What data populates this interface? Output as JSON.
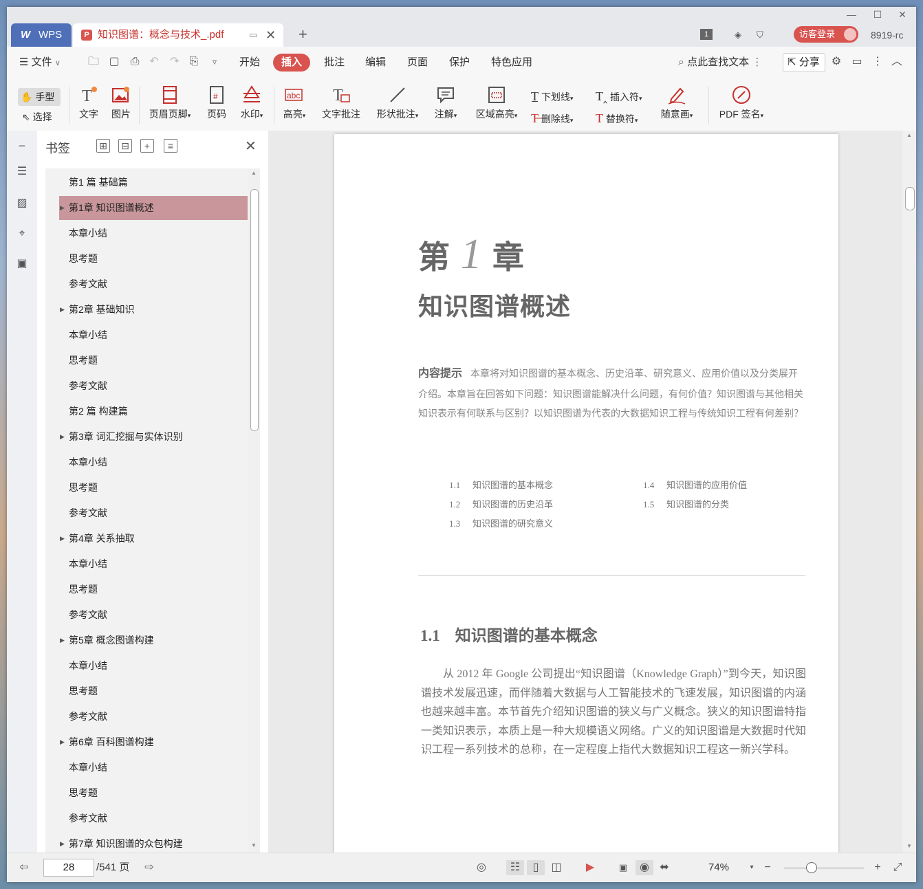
{
  "titlebar": {
    "app_tab": "WPS",
    "doc_tab": "知识图谱：概念与技术_.pdf",
    "page_indicator": "1",
    "login": "访客登录",
    "version": "8919-rc"
  },
  "menu": {
    "file": "文件",
    "tabs": [
      "开始",
      "插入",
      "批注",
      "编辑",
      "页面",
      "保护",
      "特色应用"
    ],
    "active_tab": "插入",
    "search": "点此查找文本",
    "share": "分享"
  },
  "ribbon": {
    "hand": "手型",
    "select": "选择",
    "text": "文字",
    "image": "图片",
    "header_footer": "页眉页脚",
    "page_num": "页码",
    "watermark": "水印",
    "highlight": "高亮",
    "text_annot": "文字批注",
    "shape_annot": "形状批注",
    "note": "注解",
    "area_highlight": "区域高亮",
    "underline": "下划线",
    "strikethrough": "删除线",
    "insert_char": "插入符",
    "replace_char": "替换符",
    "freehand": "随意画",
    "pdf_sign": "PDF 签名"
  },
  "bookmarks": {
    "title": "书签",
    "items": [
      {
        "label": "第1 篇 基础篇",
        "arrow": false
      },
      {
        "label": "第1章 知识图谱概述",
        "arrow": true,
        "selected": true
      },
      {
        "label": "本章小结",
        "arrow": false
      },
      {
        "label": "思考题",
        "arrow": false
      },
      {
        "label": "参考文献",
        "arrow": false
      },
      {
        "label": "第2章 基础知识",
        "arrow": true
      },
      {
        "label": "本章小结",
        "arrow": false
      },
      {
        "label": "思考题",
        "arrow": false
      },
      {
        "label": "参考文献",
        "arrow": false
      },
      {
        "label": "第2 篇 构建篇",
        "arrow": false
      },
      {
        "label": "第3章 词汇挖掘与实体识别",
        "arrow": true
      },
      {
        "label": "本章小结",
        "arrow": false
      },
      {
        "label": "思考题",
        "arrow": false
      },
      {
        "label": "参考文献",
        "arrow": false
      },
      {
        "label": "第4章 关系抽取",
        "arrow": true
      },
      {
        "label": "本章小结",
        "arrow": false
      },
      {
        "label": "思考题",
        "arrow": false
      },
      {
        "label": "参考文献",
        "arrow": false
      },
      {
        "label": "第5章 概念图谱构建",
        "arrow": true
      },
      {
        "label": "本章小结",
        "arrow": false
      },
      {
        "label": "思考题",
        "arrow": false
      },
      {
        "label": "参考文献",
        "arrow": false
      },
      {
        "label": "第6章 百科图谱构建",
        "arrow": true
      },
      {
        "label": "本章小结",
        "arrow": false
      },
      {
        "label": "思考题",
        "arrow": false
      },
      {
        "label": "参考文献",
        "arrow": false
      },
      {
        "label": "第7章 知识图谱的众包构建",
        "arrow": true
      }
    ]
  },
  "page": {
    "chapter_prefix": "第",
    "chapter_num": "1",
    "chapter_suffix": "章",
    "chapter_title": "知识图谱概述",
    "hint_label": "内容提示",
    "hint_text": "本章将对知识图谱的基本概念、历史沿革、研究意义、应用价值以及分类展开介绍。本章旨在回答如下问题：知识图谱能解决什么问题，有何价值？知识图谱与其他相关知识表示有何联系与区别？以知识图谱为代表的大数据知识工程与传统知识工程有何差别？",
    "toc": [
      {
        "no": "1.1",
        "title": "知识图谱的基本概念"
      },
      {
        "no": "1.2",
        "title": "知识图谱的历史沿革"
      },
      {
        "no": "1.3",
        "title": "知识图谱的研究意义"
      },
      {
        "no": "1.4",
        "title": "知识图谱的应用价值"
      },
      {
        "no": "1.5",
        "title": "知识图谱的分类"
      }
    ],
    "section_no": "1.1",
    "section_title": "知识图谱的基本概念",
    "body": "从 2012 年 Google 公司提出“知识图谱（Knowledge Graph）”到今天，知识图谱技术发展迅速，而伴随着大数据与人工智能技术的飞速发展，知识图谱的内涵也越来越丰富。本节首先介绍知识图谱的狭义与广义概念。狭义的知识图谱特指一类知识表示，本质上是一种大规模语义网络。广义的知识图谱是大数据时代知识工程一系列技术的总称，在一定程度上指代大数据知识工程这一新兴学科。"
  },
  "status": {
    "current_page": "28",
    "total_pages": "/541 页",
    "zoom": "74%"
  }
}
